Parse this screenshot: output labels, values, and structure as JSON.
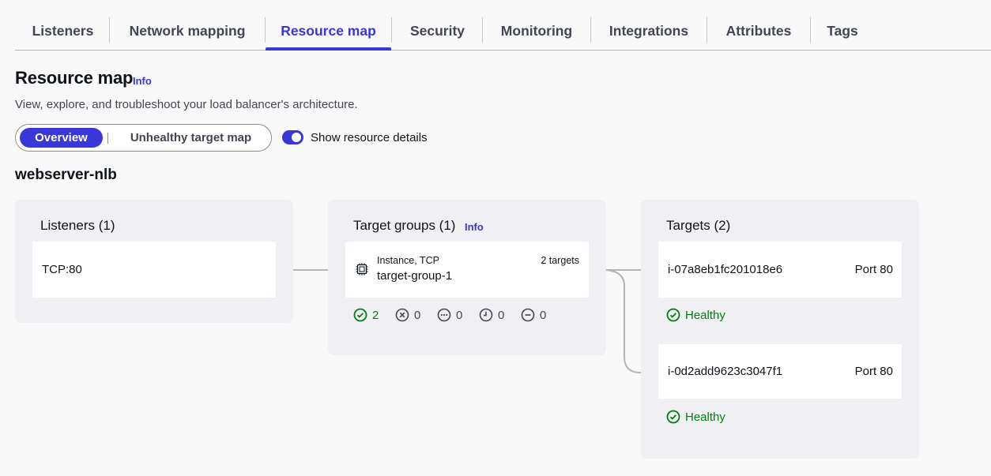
{
  "tabs": [
    {
      "label": "Listeners"
    },
    {
      "label": "Network mapping"
    },
    {
      "label": "Resource map"
    },
    {
      "label": "Security"
    },
    {
      "label": "Monitoring"
    },
    {
      "label": "Integrations"
    },
    {
      "label": "Attributes"
    },
    {
      "label": "Tags"
    }
  ],
  "active_tab": "Resource map",
  "header": {
    "title": "Resource map",
    "info": "Info",
    "description": "View, explore, and troubleshoot your load balancer's architecture."
  },
  "view_mode": {
    "options": [
      "Overview",
      "Unhealthy target map"
    ],
    "selected": "Overview"
  },
  "show_details": {
    "label": "Show resource details",
    "enabled": true
  },
  "load_balancer": {
    "name": "webserver-nlb"
  },
  "listeners": {
    "title": "Listeners (1)",
    "items": [
      {
        "label": "TCP:80"
      }
    ]
  },
  "target_groups": {
    "title": "Target groups (1)",
    "info": "Info",
    "items": [
      {
        "type": "Instance, TCP",
        "name": "target-group-1",
        "targets_count": "2 targets",
        "stats": {
          "healthy": "2",
          "unhealthy": "0",
          "unused": "0",
          "draining": "0",
          "unavailable": "0"
        }
      }
    ]
  },
  "targets": {
    "title": "Targets (2)",
    "items": [
      {
        "id": "i-07a8eb1fc201018e6",
        "port": "Port 80",
        "status": "Healthy"
      },
      {
        "id": "i-0d2add9623c3047f1",
        "port": "Port 80",
        "status": "Healthy"
      }
    ]
  },
  "colors": {
    "accent": "#3a37d8",
    "healthy": "#037f0c",
    "muted": "#424650"
  }
}
